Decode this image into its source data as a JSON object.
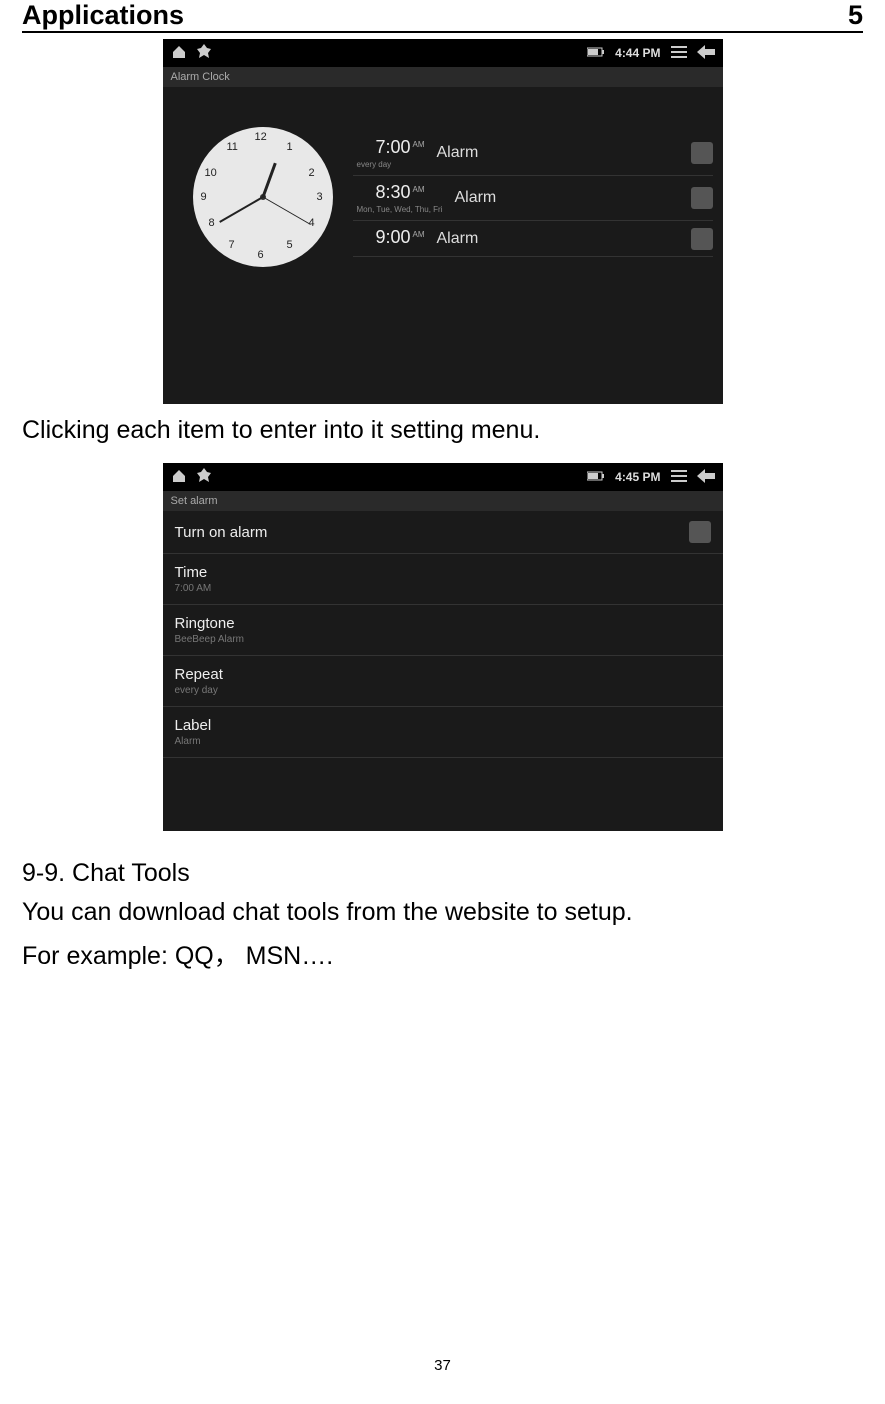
{
  "header": {
    "left": "Applications",
    "right": "5"
  },
  "shot1": {
    "time": "4:44 PM",
    "titlebar": "Alarm Clock",
    "clock_numbers": [
      "12",
      "1",
      "2",
      "3",
      "4",
      "5",
      "6",
      "7",
      "8",
      "9",
      "10",
      "11"
    ],
    "alarms": [
      {
        "time": "7:00",
        "ampm": "AM",
        "label": "Alarm",
        "sub": "every day"
      },
      {
        "time": "8:30",
        "ampm": "AM",
        "label": "Alarm",
        "sub": "Mon, Tue, Wed, Thu, Fri"
      },
      {
        "time": "9:00",
        "ampm": "AM",
        "label": "Alarm",
        "sub": ""
      }
    ]
  },
  "caption1": "Clicking each item to enter into it setting menu.",
  "shot2": {
    "time": "4:45 PM",
    "titlebar": "Set alarm",
    "rows": [
      {
        "main": "Turn on alarm",
        "sub": "",
        "checkbox": true
      },
      {
        "main": "Time",
        "sub": "7:00 AM"
      },
      {
        "main": "Ringtone",
        "sub": "BeeBeep Alarm"
      },
      {
        "main": "Repeat",
        "sub": "every day"
      },
      {
        "main": "Label",
        "sub": "Alarm"
      }
    ]
  },
  "section": {
    "heading_num": "9-9.",
    "heading_text": "Chat Tools",
    "p1": "You can download chat tools from the website to setup.",
    "p2": "For example: QQ， MSN…."
  },
  "page_number": "37"
}
